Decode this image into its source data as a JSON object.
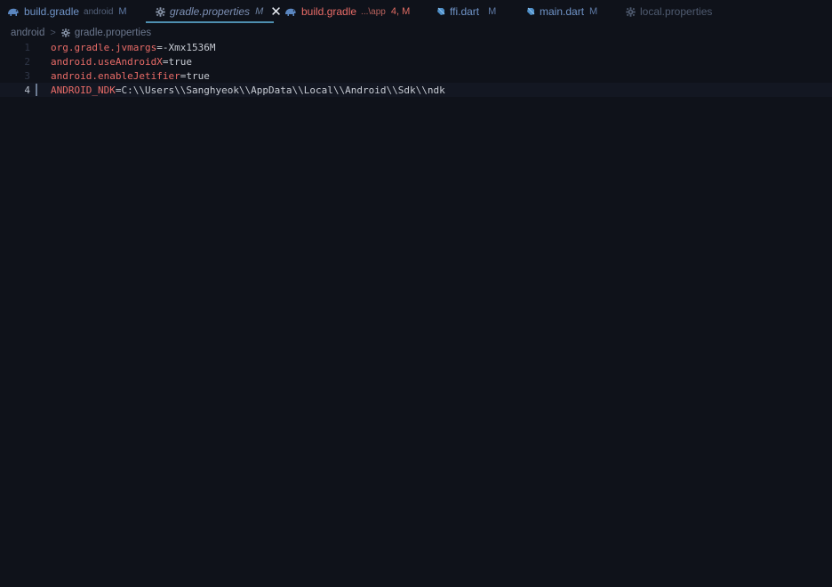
{
  "tabs": [
    {
      "name": "build.gradle",
      "hint": "android",
      "mod": "M",
      "icon": "gradle-elephant-icon",
      "state": "normal"
    },
    {
      "name": "gradle.properties",
      "hint": "",
      "mod": "M",
      "icon": "gear-icon",
      "state": "active"
    },
    {
      "name": "build.gradle",
      "hint": "...\\app",
      "mod": "4, M",
      "icon": "gradle-elephant-icon",
      "state": "error"
    },
    {
      "name": "ffi.dart",
      "hint": "",
      "mod": "M",
      "icon": "dart-icon",
      "state": "normal"
    },
    {
      "name": "main.dart",
      "hint": "",
      "mod": "M",
      "icon": "dart-icon",
      "state": "normal"
    },
    {
      "name": "local.properties",
      "hint": "",
      "mod": "",
      "icon": "gear-icon",
      "state": "dim"
    }
  ],
  "close_glyph": "✕",
  "breadcrumb": {
    "folder": "android",
    "file": "gradle.properties"
  },
  "lines": [
    {
      "num": "1",
      "key": "org.gradle.jvmargs",
      "eq": "=",
      "value": "-Xmx1536M"
    },
    {
      "num": "2",
      "key": "android.useAndroidX",
      "eq": "=",
      "value": "true"
    },
    {
      "num": "3",
      "key": "android.enableJetifier",
      "eq": "=",
      "value": "true"
    },
    {
      "num": "4",
      "key": "ANDROID_NDK",
      "eq": "=",
      "value": "C:\\\\Users\\\\Sanghyeok\\\\AppData\\\\Local\\\\Android\\\\Sdk\\\\ndk"
    }
  ],
  "colors": {
    "background": "#0f121a",
    "tab_text": "#6f93c7",
    "error_text": "#e86b67",
    "key_color": "#e86b67",
    "value_color": "#c7cbd3",
    "active_underline": "#4e8fb0"
  }
}
